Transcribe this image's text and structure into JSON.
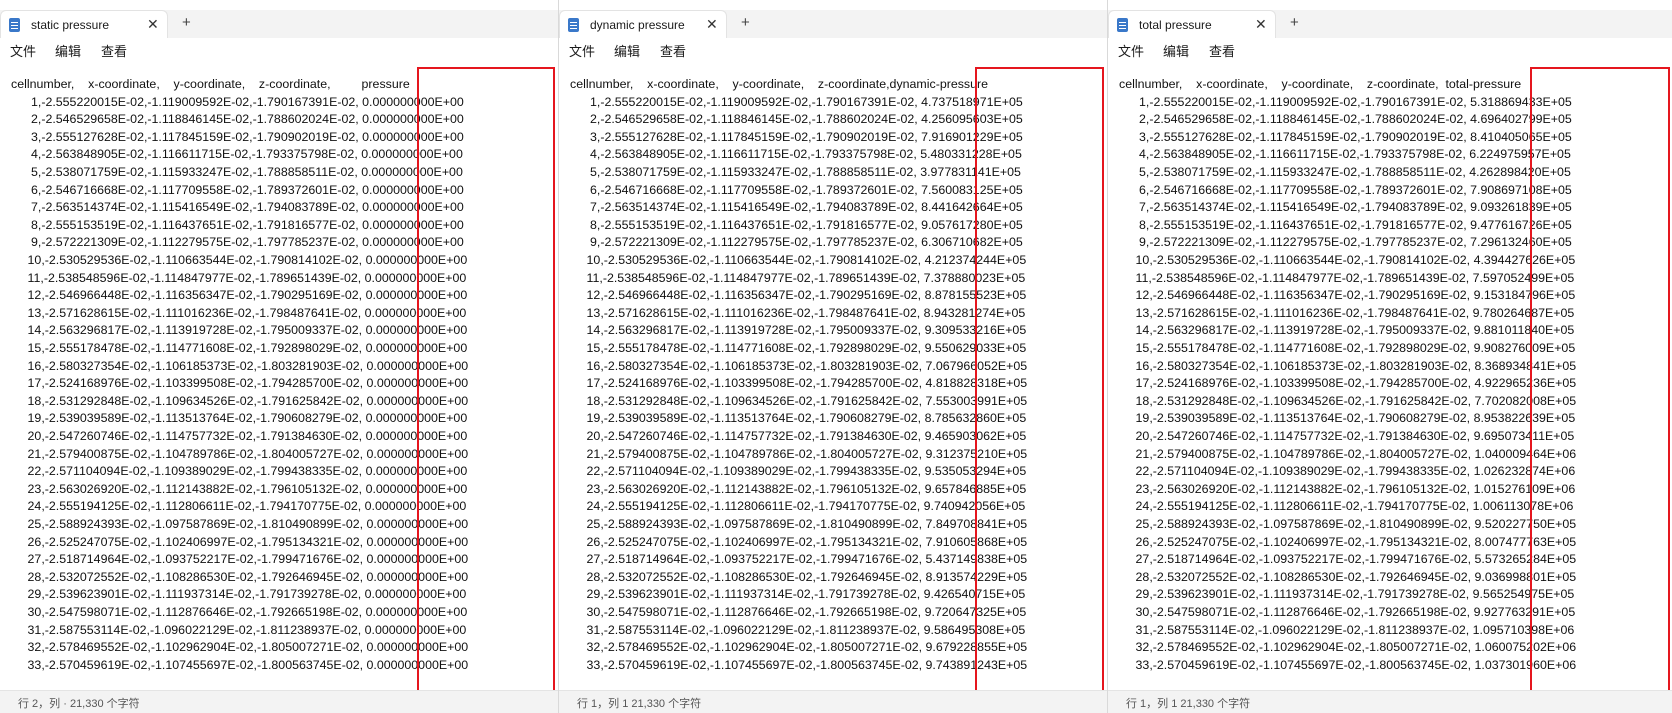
{
  "highlight_color": "#e5161e",
  "new_tab_symbol": "+",
  "close_symbol": "✕",
  "windows": [
    {
      "tab_title": "static pressure",
      "menu": [
        "文件",
        "编辑",
        "查看"
      ],
      "status": "行 2，列 · 21,330 个字符",
      "header": "cellnumber,    x-coordinate,    y-coordinate,    z-coordinate,         pressure",
      "lines": [
        "         1,-2.555220015E-02,-1.119009592E-02,-1.790167391E-02, 0.000000000E+00",
        "         2,-2.546529658E-02,-1.118846145E-02,-1.788602024E-02, 0.000000000E+00",
        "         3,-2.555127628E-02,-1.117845159E-02,-1.790902019E-02, 0.000000000E+00",
        "         4,-2.563848905E-02,-1.116611715E-02,-1.793375798E-02, 0.000000000E+00",
        "         5,-2.538071759E-02,-1.115933247E-02,-1.788858511E-02, 0.000000000E+00",
        "         6,-2.546716668E-02,-1.117709558E-02,-1.789372601E-02, 0.000000000E+00",
        "         7,-2.563514374E-02,-1.115416549E-02,-1.794083789E-02, 0.000000000E+00",
        "         8,-2.555153519E-02,-1.116437651E-02,-1.791816577E-02, 0.000000000E+00",
        "         9,-2.572221309E-02,-1.112279575E-02,-1.797785237E-02, 0.000000000E+00",
        "        10,-2.530529536E-02,-1.110663544E-02,-1.790814102E-02, 0.000000000E+00",
        "        11,-2.538548596E-02,-1.114847977E-02,-1.789651439E-02, 0.000000000E+00",
        "        12,-2.546966448E-02,-1.116356347E-02,-1.790295169E-02, 0.000000000E+00",
        "        13,-2.571628615E-02,-1.111016236E-02,-1.798487641E-02, 0.000000000E+00",
        "        14,-2.563296817E-02,-1.113919728E-02,-1.795009337E-02, 0.000000000E+00",
        "        15,-2.555178478E-02,-1.114771608E-02,-1.792898029E-02, 0.000000000E+00",
        "        16,-2.580327354E-02,-1.106185373E-02,-1.803281903E-02, 0.000000000E+00",
        "        17,-2.524168976E-02,-1.103399508E-02,-1.794285700E-02, 0.000000000E+00",
        "        18,-2.531292848E-02,-1.109634526E-02,-1.791625842E-02, 0.000000000E+00",
        "        19,-2.539039589E-02,-1.113513764E-02,-1.790608279E-02, 0.000000000E+00",
        "        20,-2.547260746E-02,-1.114757732E-02,-1.791384630E-02, 0.000000000E+00",
        "        21,-2.579400875E-02,-1.104789786E-02,-1.804005727E-02, 0.000000000E+00",
        "        22,-2.571104094E-02,-1.109389029E-02,-1.799438335E-02, 0.000000000E+00",
        "        23,-2.563026920E-02,-1.112143882E-02,-1.796105132E-02, 0.000000000E+00",
        "        24,-2.555194125E-02,-1.112806611E-02,-1.794170775E-02, 0.000000000E+00",
        "        25,-2.588924393E-02,-1.097587869E-02,-1.810490899E-02, 0.000000000E+00",
        "        26,-2.525247075E-02,-1.102406997E-02,-1.795134321E-02, 0.000000000E+00",
        "        27,-2.518714964E-02,-1.093752217E-02,-1.799471676E-02, 0.000000000E+00",
        "        28,-2.532072552E-02,-1.108286530E-02,-1.792646945E-02, 0.000000000E+00",
        "        29,-2.539623901E-02,-1.111937314E-02,-1.791739278E-02, 0.000000000E+00",
        "        30,-2.547598071E-02,-1.112876646E-02,-1.792665198E-02, 0.000000000E+00",
        "        31,-2.587553114E-02,-1.096022129E-02,-1.811238937E-02, 0.000000000E+00",
        "        32,-2.578469552E-02,-1.102962904E-02,-1.805007271E-02, 0.000000000E+00",
        "        33,-2.570459619E-02,-1.107455697E-02,-1.800563745E-02, 0.000000000E+00"
      ]
    },
    {
      "tab_title": "dynamic pressure",
      "menu": [
        "文件",
        "编辑",
        "查看"
      ],
      "status": "行 1，列 1   21,330 个字符",
      "header": "cellnumber,    x-coordinate,    y-coordinate,    z-coordinate,dynamic-pressure",
      "lines": [
        "         1,-2.555220015E-02,-1.119009592E-02,-1.790167391E-02, 4.737518971E+05",
        "         2,-2.546529658E-02,-1.118846145E-02,-1.788602024E-02, 4.256095603E+05",
        "         3,-2.555127628E-02,-1.117845159E-02,-1.790902019E-02, 7.916901229E+05",
        "         4,-2.563848905E-02,-1.116611715E-02,-1.793375798E-02, 5.480331228E+05",
        "         5,-2.538071759E-02,-1.115933247E-02,-1.788858511E-02, 3.977831141E+05",
        "         6,-2.546716668E-02,-1.117709558E-02,-1.789372601E-02, 7.560083125E+05",
        "         7,-2.563514374E-02,-1.115416549E-02,-1.794083789E-02, 8.441642664E+05",
        "         8,-2.555153519E-02,-1.116437651E-02,-1.791816577E-02, 9.057617280E+05",
        "         9,-2.572221309E-02,-1.112279575E-02,-1.797785237E-02, 6.306710682E+05",
        "        10,-2.530529536E-02,-1.110663544E-02,-1.790814102E-02, 4.212374244E+05",
        "        11,-2.538548596E-02,-1.114847977E-02,-1.789651439E-02, 7.378880023E+05",
        "        12,-2.546966448E-02,-1.116356347E-02,-1.790295169E-02, 8.878155523E+05",
        "        13,-2.571628615E-02,-1.111016236E-02,-1.798487641E-02, 8.943281274E+05",
        "        14,-2.563296817E-02,-1.113919728E-02,-1.795009337E-02, 9.309533216E+05",
        "        15,-2.555178478E-02,-1.114771608E-02,-1.792898029E-02, 9.550629033E+05",
        "        16,-2.580327354E-02,-1.106185373E-02,-1.803281903E-02, 7.067966052E+05",
        "        17,-2.524168976E-02,-1.103399508E-02,-1.794285700E-02, 4.818828318E+05",
        "        18,-2.531292848E-02,-1.109634526E-02,-1.791625842E-02, 7.553003991E+05",
        "        19,-2.539039589E-02,-1.113513764E-02,-1.790608279E-02, 8.785632860E+05",
        "        20,-2.547260746E-02,-1.114757732E-02,-1.791384630E-02, 9.465903062E+05",
        "        21,-2.579400875E-02,-1.104789786E-02,-1.804005727E-02, 9.312375210E+05",
        "        22,-2.571104094E-02,-1.109389029E-02,-1.799438335E-02, 9.535053294E+05",
        "        23,-2.563026920E-02,-1.112143882E-02,-1.796105132E-02, 9.657846885E+05",
        "        24,-2.555194125E-02,-1.112806611E-02,-1.794170775E-02, 9.740942056E+05",
        "        25,-2.588924393E-02,-1.097587869E-02,-1.810490899E-02, 7.849708841E+05",
        "        26,-2.525247075E-02,-1.102406997E-02,-1.795134321E-02, 7.910605868E+05",
        "        27,-2.518714964E-02,-1.093752217E-02,-1.799471676E-02, 5.437149838E+05",
        "        28,-2.532072552E-02,-1.108286530E-02,-1.792646945E-02, 8.913574229E+05",
        "        29,-2.539623901E-02,-1.111937314E-02,-1.791739278E-02, 9.426540715E+05",
        "        30,-2.547598071E-02,-1.112876646E-02,-1.792665198E-02, 9.720647325E+05",
        "        31,-2.587553114E-02,-1.096022129E-02,-1.811238937E-02, 9.586495308E+05",
        "        32,-2.578469552E-02,-1.102962904E-02,-1.805007271E-02, 9.679228855E+05",
        "        33,-2.570459619E-02,-1.107455697E-02,-1.800563745E-02, 9.743891243E+05"
      ]
    },
    {
      "tab_title": "total pressure",
      "menu": [
        "文件",
        "编辑",
        "查看"
      ],
      "status": "行 1，列 1   21,330 个字符",
      "header": "cellnumber,    x-coordinate,    y-coordinate,    z-coordinate,  total-pressure",
      "lines": [
        "         1,-2.555220015E-02,-1.119009592E-02,-1.790167391E-02, 5.318869433E+05",
        "         2,-2.546529658E-02,-1.118846145E-02,-1.788602024E-02, 4.696402799E+05",
        "         3,-2.555127628E-02,-1.117845159E-02,-1.790902019E-02, 8.410405065E+05",
        "         4,-2.563848905E-02,-1.116611715E-02,-1.793375798E-02, 6.224975957E+05",
        "         5,-2.538071759E-02,-1.115933247E-02,-1.788858511E-02, 4.262898420E+05",
        "         6,-2.546716668E-02,-1.117709558E-02,-1.789372601E-02, 7.908697108E+05",
        "         7,-2.563514374E-02,-1.115416549E-02,-1.794083789E-02, 9.093261839E+05",
        "         8,-2.555153519E-02,-1.116437651E-02,-1.791816577E-02, 9.477616726E+05",
        "         9,-2.572221309E-02,-1.112279575E-02,-1.797785237E-02, 7.296132460E+05",
        "        10,-2.530529536E-02,-1.110663544E-02,-1.790814102E-02, 4.394427626E+05",
        "        11,-2.538548596E-02,-1.114847977E-02,-1.789651439E-02, 7.597052499E+05",
        "        12,-2.546966448E-02,-1.116356347E-02,-1.790295169E-02, 9.153184796E+05",
        "        13,-2.571628615E-02,-1.111016236E-02,-1.798487641E-02, 9.780264687E+05",
        "        14,-2.563296817E-02,-1.113919728E-02,-1.795009337E-02, 9.881011840E+05",
        "        15,-2.555178478E-02,-1.114771608E-02,-1.792898029E-02, 9.908276009E+05",
        "        16,-2.580327354E-02,-1.106185373E-02,-1.803281903E-02, 8.368934841E+05",
        "        17,-2.524168976E-02,-1.103399508E-02,-1.794285700E-02, 4.922965236E+05",
        "        18,-2.531292848E-02,-1.109634526E-02,-1.791625842E-02, 7.702082008E+05",
        "        19,-2.539039589E-02,-1.113513764E-02,-1.790608279E-02, 8.953822639E+05",
        "        20,-2.547260746E-02,-1.114757732E-02,-1.791384630E-02, 9.695073411E+05",
        "        21,-2.579400875E-02,-1.104789786E-02,-1.804005727E-02, 1.040009464E+06",
        "        22,-2.571104094E-02,-1.109389029E-02,-1.799438335E-02, 1.026232874E+06",
        "        23,-2.563026920E-02,-1.112143882E-02,-1.796105132E-02, 1.015276109E+06",
        "        24,-2.555194125E-02,-1.112806611E-02,-1.794170775E-02, 1.006113078E+06",
        "        25,-2.588924393E-02,-1.097587869E-02,-1.810490899E-02, 9.520227750E+05",
        "        26,-2.525247075E-02,-1.102406997E-02,-1.795134321E-02, 8.007477763E+05",
        "        27,-2.518714964E-02,-1.093752217E-02,-1.799471676E-02, 5.573265284E+05",
        "        28,-2.532072552E-02,-1.108286530E-02,-1.792646945E-02, 9.036998801E+05",
        "        29,-2.539623901E-02,-1.111937314E-02,-1.791739278E-02, 9.565254975E+05",
        "        30,-2.547598071E-02,-1.112876646E-02,-1.792665198E-02, 9.927763291E+05",
        "        31,-2.587553114E-02,-1.096022129E-02,-1.811238937E-02, 1.095710398E+06",
        "        32,-2.578469552E-02,-1.102962904E-02,-1.805007271E-02, 1.060075202E+06",
        "        33,-2.570459619E-02,-1.107455697E-02,-1.800563745E-02, 1.037301960E+06"
      ]
    }
  ]
}
